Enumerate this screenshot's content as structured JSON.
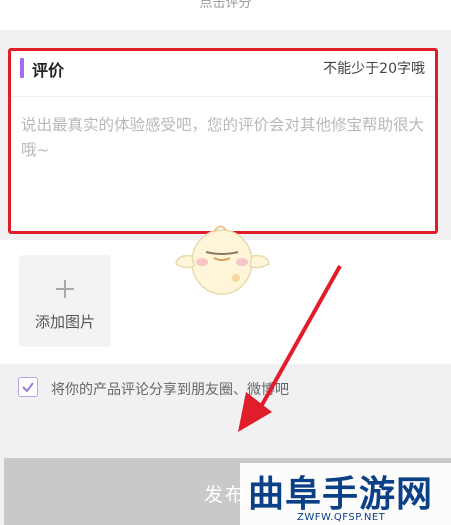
{
  "rating": {
    "hint": "点击评分"
  },
  "review": {
    "title": "评价",
    "min_length_hint": "不能少于20字哦",
    "placeholder": "说出最真实的体验感受吧，您的评价会对其他修宝帮助很大哦~",
    "value": ""
  },
  "photos": {
    "add_label": "添加图片",
    "icon": "plus-icon"
  },
  "share": {
    "checked": true,
    "label": "将你的产品评论分享到朋友圈、微博吧"
  },
  "publish": {
    "label": "发布"
  },
  "watermark": {
    "logo_text": "曲阜手游网",
    "url": "ZWFW.QFSP.NET"
  },
  "colors": {
    "accent": "#a46cf0",
    "highlight_border": "#e11d2a",
    "annotation_arrow": "#e11d2a",
    "publish_bar": "#c9c9c9",
    "watermark_text": "#0b3f86"
  }
}
